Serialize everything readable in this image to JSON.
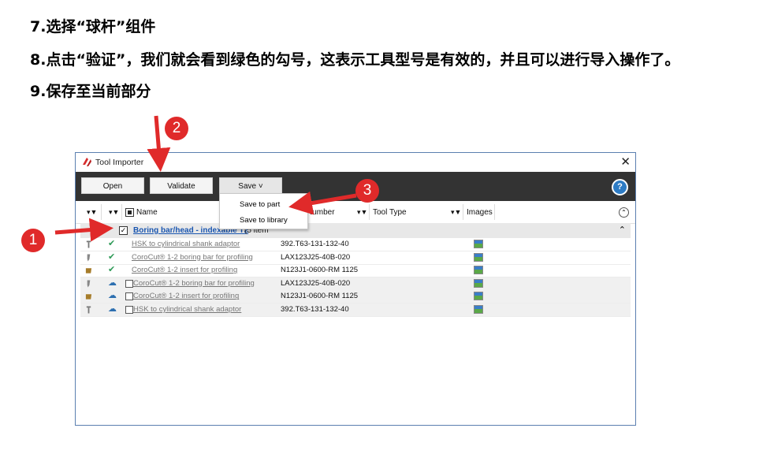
{
  "instructions": {
    "line1": "7.选择“球杆”组件",
    "line2": "8.点击“验证”，我们就会看到绿色的勾号，这表示工具型号是有效的，并且可以进行导入操作了。",
    "line3": "9.保存至当前部分"
  },
  "window": {
    "title": "Tool Importer",
    "close": "✕"
  },
  "toolbar": {
    "open": "Open",
    "validate": "Validate",
    "save": "Save ˅",
    "help": "?"
  },
  "columns": {
    "name": "Name",
    "number": "Number",
    "tool_type": "Tool Type",
    "images": "Images",
    "filter": "▾▼",
    "collapse": "⌃"
  },
  "group": {
    "name": "Boring bar/head - indexable T2",
    "count": "(5 item",
    "check": "✓",
    "toggle": "⌃"
  },
  "rows": [
    {
      "status": "✔",
      "name": "HSK to cylindrical shank adaptor",
      "number": "392.T63-131-132-40",
      "type": "holder"
    },
    {
      "status": "✔",
      "name": "CoroCut® 1-2 boring bar for profiling",
      "number": "LAX123J25-40B-020",
      "type": "bar"
    },
    {
      "status": "✔",
      "name": "CoroCut® 1-2 insert for profiling",
      "number": "N123J1-0600-RM     1125",
      "type": "insert"
    },
    {
      "status": "☁",
      "name": "CoroCut® 1-2 boring bar for profiling",
      "number": "LAX123J25-40B-020",
      "type": "bar"
    },
    {
      "status": "☁",
      "name": "CoroCut® 1-2 insert for profiling",
      "number": "N123J1-0600-RM     1125",
      "type": "insert"
    },
    {
      "status": "☁",
      "name": "HSK to cylindrical shank adaptor",
      "number": "392.T63-131-132-40",
      "type": "holder"
    }
  ],
  "save_menu": {
    "to_part": "Save to part",
    "to_library": "Save to library"
  },
  "markers": {
    "m1": "1",
    "m2": "2",
    "m3": "3"
  },
  "colors": {
    "toolbar": "#333333",
    "check": "#2e9a57",
    "link": "#1a56b0",
    "marker": "#e02a2a"
  }
}
